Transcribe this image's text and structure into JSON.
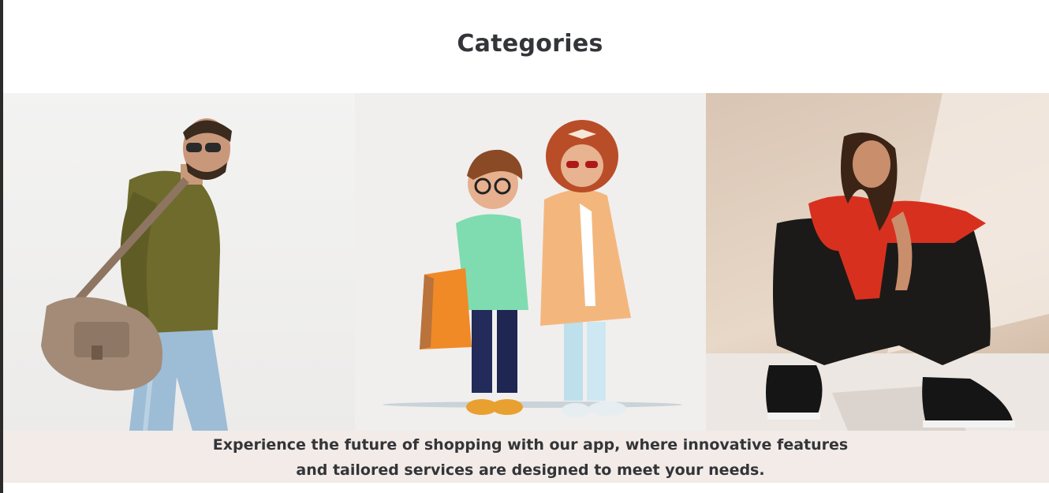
{
  "section": {
    "title": "Categories",
    "caption": "Experience the future of shopping with our app, where innovative features and tailored services are designed to meet your needs."
  },
  "categories": [
    {
      "image": "man-with-bag-photo"
    },
    {
      "image": "kids-photo"
    },
    {
      "image": "woman-in-red-photo"
    }
  ],
  "colors": {
    "title_text": "#333538",
    "caption_band": "#f3ebe8",
    "edge": "#2b2b2b"
  }
}
